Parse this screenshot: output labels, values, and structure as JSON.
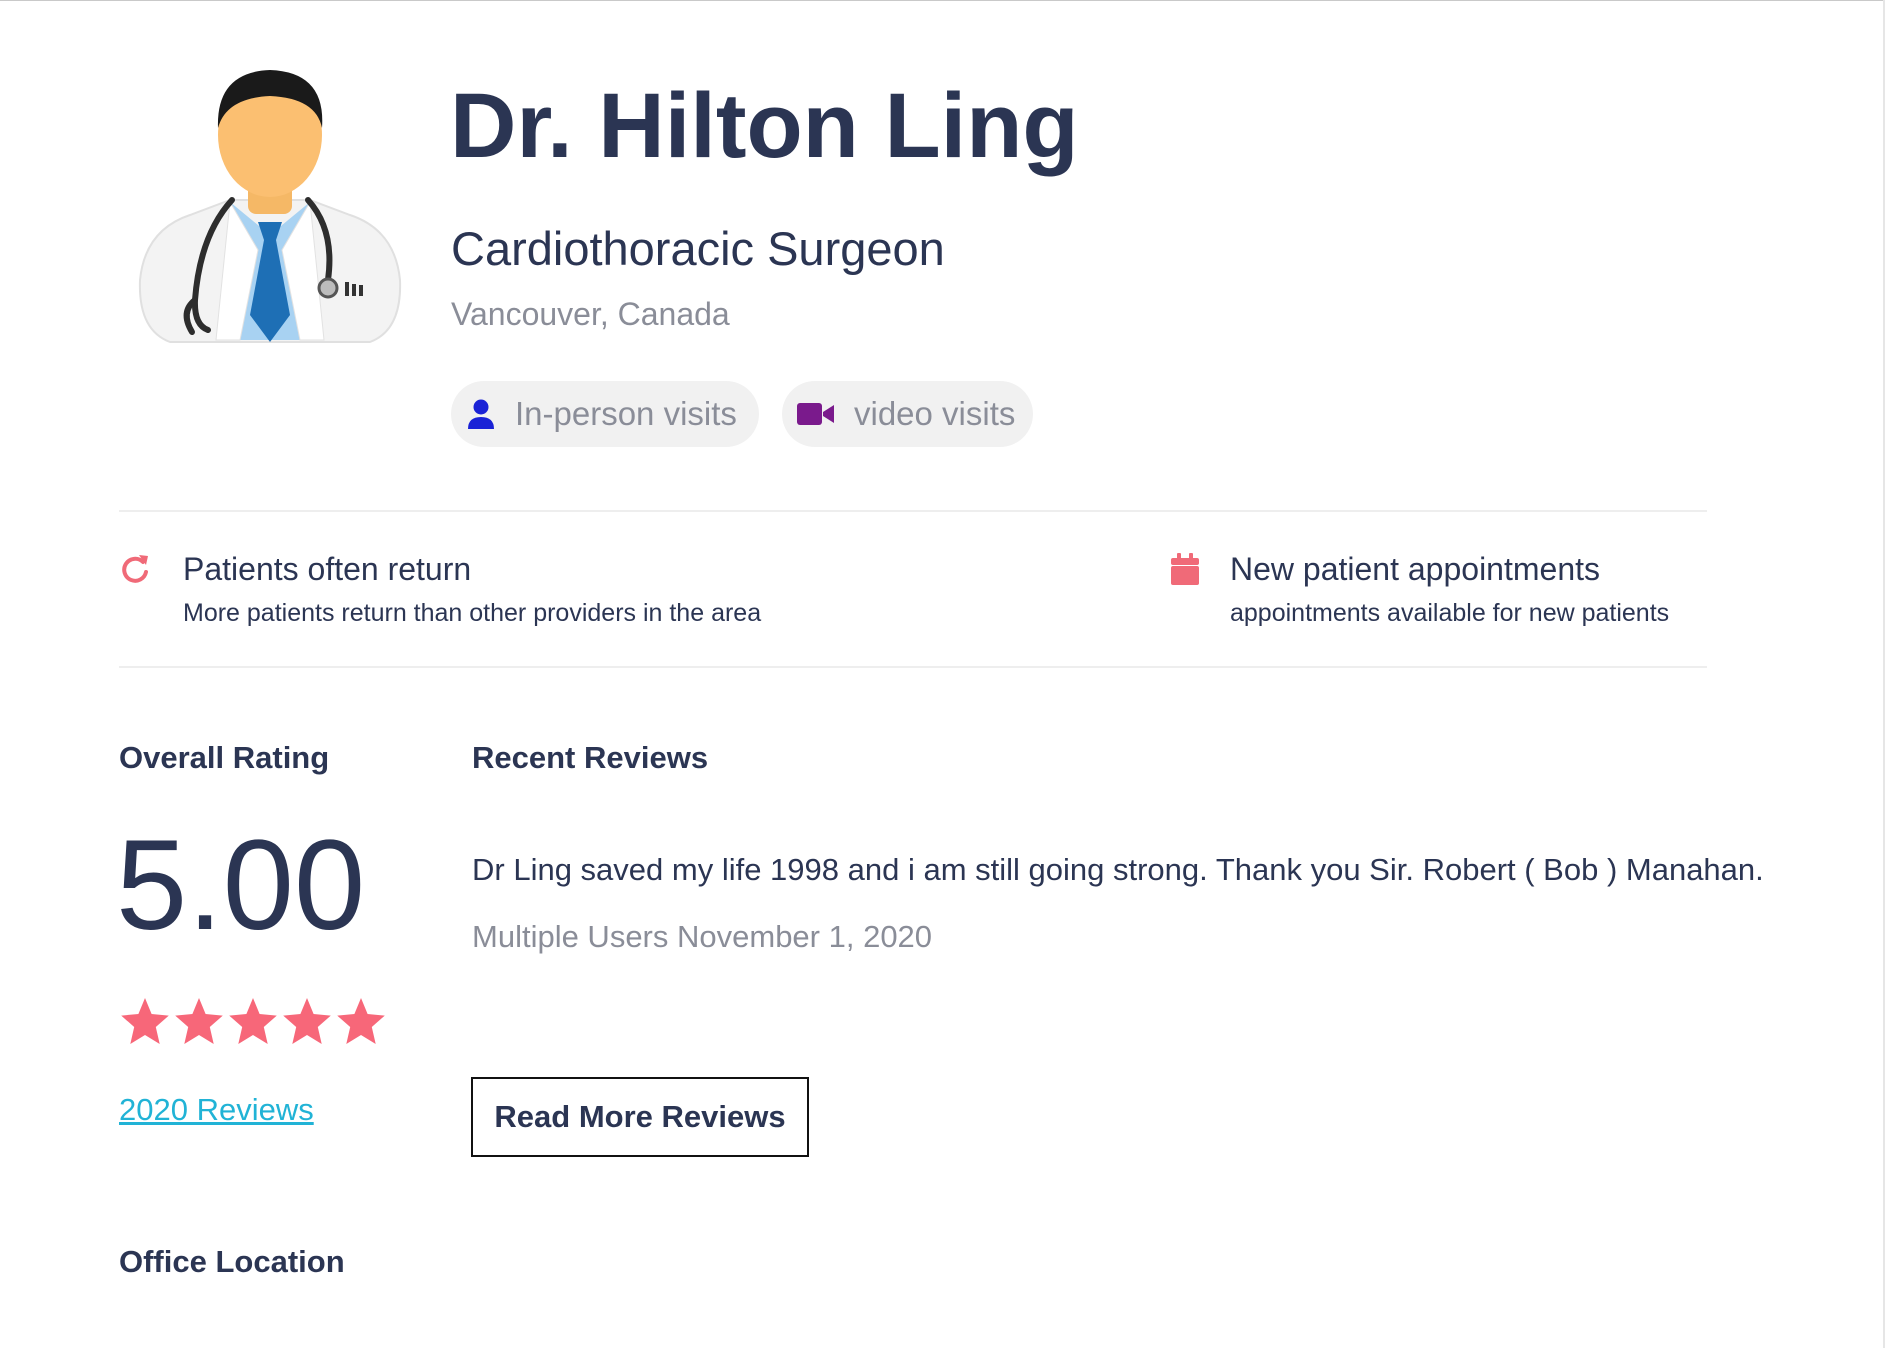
{
  "doctor": {
    "name": "Dr. Hilton Ling",
    "specialty": "Cardiothoracic Surgeon",
    "location": "Vancouver, Canada",
    "avatar_icon": "doctor-avatar-icon"
  },
  "visit_types": [
    {
      "label": "In-person visits",
      "icon": "person-icon",
      "icon_color": "#1a22d6"
    },
    {
      "label": "video visits",
      "icon": "video-camera-icon",
      "icon_color": "#7a1a8c"
    }
  ],
  "features": [
    {
      "title": "Patients often return",
      "description": "More patients return than other providers in the area",
      "icon": "refresh-icon",
      "icon_color": "#f06a78"
    },
    {
      "title": "New patient appointments",
      "description": "appointments available for new patients",
      "icon": "calendar-icon",
      "icon_color": "#f06a78"
    }
  ],
  "rating": {
    "heading": "Overall Rating",
    "value": "5.00",
    "stars": 5,
    "star_color": "#f76779",
    "reviews_link": "2020 Reviews"
  },
  "recent_reviews": {
    "heading": "Recent Reviews",
    "items": [
      {
        "text": "Dr Ling saved my life 1998 and i am still going strong. Thank you Sir. Robert ( Bob ) Manahan.",
        "meta": "Multiple Users November 1, 2020"
      }
    ],
    "read_more_label": "Read More Reviews"
  },
  "office": {
    "heading": "Office Location"
  },
  "colors": {
    "text": "#2b3553",
    "muted": "#8a8d98",
    "link": "#21b3d6",
    "accent": "#f76779"
  }
}
